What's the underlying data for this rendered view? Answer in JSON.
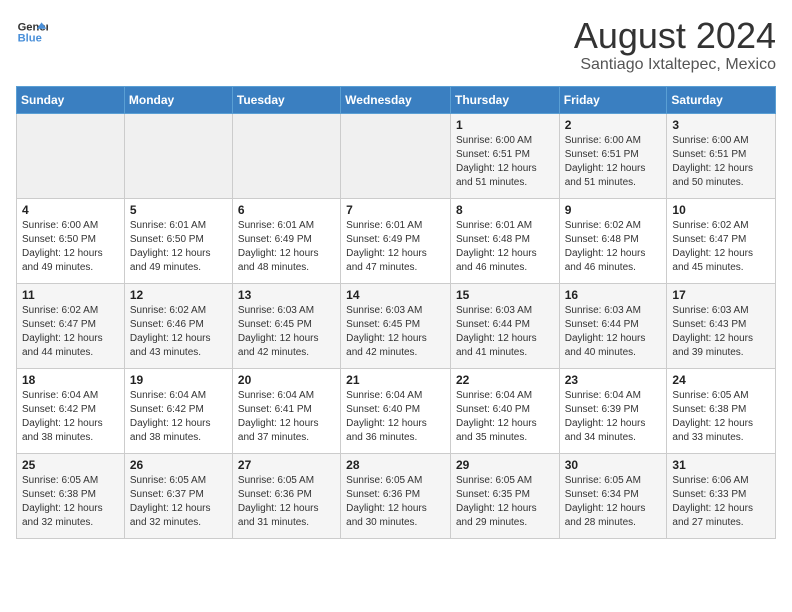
{
  "header": {
    "logo_line1": "General",
    "logo_line2": "Blue",
    "main_title": "August 2024",
    "sub_title": "Santiago Ixtaltepec, Mexico"
  },
  "weekdays": [
    "Sunday",
    "Monday",
    "Tuesday",
    "Wednesday",
    "Thursday",
    "Friday",
    "Saturday"
  ],
  "weeks": [
    [
      {
        "day": "",
        "info": ""
      },
      {
        "day": "",
        "info": ""
      },
      {
        "day": "",
        "info": ""
      },
      {
        "day": "",
        "info": ""
      },
      {
        "day": "1",
        "info": "Sunrise: 6:00 AM\nSunset: 6:51 PM\nDaylight: 12 hours\nand 51 minutes."
      },
      {
        "day": "2",
        "info": "Sunrise: 6:00 AM\nSunset: 6:51 PM\nDaylight: 12 hours\nand 51 minutes."
      },
      {
        "day": "3",
        "info": "Sunrise: 6:00 AM\nSunset: 6:51 PM\nDaylight: 12 hours\nand 50 minutes."
      }
    ],
    [
      {
        "day": "4",
        "info": "Sunrise: 6:00 AM\nSunset: 6:50 PM\nDaylight: 12 hours\nand 49 minutes."
      },
      {
        "day": "5",
        "info": "Sunrise: 6:01 AM\nSunset: 6:50 PM\nDaylight: 12 hours\nand 49 minutes."
      },
      {
        "day": "6",
        "info": "Sunrise: 6:01 AM\nSunset: 6:49 PM\nDaylight: 12 hours\nand 48 minutes."
      },
      {
        "day": "7",
        "info": "Sunrise: 6:01 AM\nSunset: 6:49 PM\nDaylight: 12 hours\nand 47 minutes."
      },
      {
        "day": "8",
        "info": "Sunrise: 6:01 AM\nSunset: 6:48 PM\nDaylight: 12 hours\nand 46 minutes."
      },
      {
        "day": "9",
        "info": "Sunrise: 6:02 AM\nSunset: 6:48 PM\nDaylight: 12 hours\nand 46 minutes."
      },
      {
        "day": "10",
        "info": "Sunrise: 6:02 AM\nSunset: 6:47 PM\nDaylight: 12 hours\nand 45 minutes."
      }
    ],
    [
      {
        "day": "11",
        "info": "Sunrise: 6:02 AM\nSunset: 6:47 PM\nDaylight: 12 hours\nand 44 minutes."
      },
      {
        "day": "12",
        "info": "Sunrise: 6:02 AM\nSunset: 6:46 PM\nDaylight: 12 hours\nand 43 minutes."
      },
      {
        "day": "13",
        "info": "Sunrise: 6:03 AM\nSunset: 6:45 PM\nDaylight: 12 hours\nand 42 minutes."
      },
      {
        "day": "14",
        "info": "Sunrise: 6:03 AM\nSunset: 6:45 PM\nDaylight: 12 hours\nand 42 minutes."
      },
      {
        "day": "15",
        "info": "Sunrise: 6:03 AM\nSunset: 6:44 PM\nDaylight: 12 hours\nand 41 minutes."
      },
      {
        "day": "16",
        "info": "Sunrise: 6:03 AM\nSunset: 6:44 PM\nDaylight: 12 hours\nand 40 minutes."
      },
      {
        "day": "17",
        "info": "Sunrise: 6:03 AM\nSunset: 6:43 PM\nDaylight: 12 hours\nand 39 minutes."
      }
    ],
    [
      {
        "day": "18",
        "info": "Sunrise: 6:04 AM\nSunset: 6:42 PM\nDaylight: 12 hours\nand 38 minutes."
      },
      {
        "day": "19",
        "info": "Sunrise: 6:04 AM\nSunset: 6:42 PM\nDaylight: 12 hours\nand 38 minutes."
      },
      {
        "day": "20",
        "info": "Sunrise: 6:04 AM\nSunset: 6:41 PM\nDaylight: 12 hours\nand 37 minutes."
      },
      {
        "day": "21",
        "info": "Sunrise: 6:04 AM\nSunset: 6:40 PM\nDaylight: 12 hours\nand 36 minutes."
      },
      {
        "day": "22",
        "info": "Sunrise: 6:04 AM\nSunset: 6:40 PM\nDaylight: 12 hours\nand 35 minutes."
      },
      {
        "day": "23",
        "info": "Sunrise: 6:04 AM\nSunset: 6:39 PM\nDaylight: 12 hours\nand 34 minutes."
      },
      {
        "day": "24",
        "info": "Sunrise: 6:05 AM\nSunset: 6:38 PM\nDaylight: 12 hours\nand 33 minutes."
      }
    ],
    [
      {
        "day": "25",
        "info": "Sunrise: 6:05 AM\nSunset: 6:38 PM\nDaylight: 12 hours\nand 32 minutes."
      },
      {
        "day": "26",
        "info": "Sunrise: 6:05 AM\nSunset: 6:37 PM\nDaylight: 12 hours\nand 32 minutes."
      },
      {
        "day": "27",
        "info": "Sunrise: 6:05 AM\nSunset: 6:36 PM\nDaylight: 12 hours\nand 31 minutes."
      },
      {
        "day": "28",
        "info": "Sunrise: 6:05 AM\nSunset: 6:36 PM\nDaylight: 12 hours\nand 30 minutes."
      },
      {
        "day": "29",
        "info": "Sunrise: 6:05 AM\nSunset: 6:35 PM\nDaylight: 12 hours\nand 29 minutes."
      },
      {
        "day": "30",
        "info": "Sunrise: 6:05 AM\nSunset: 6:34 PM\nDaylight: 12 hours\nand 28 minutes."
      },
      {
        "day": "31",
        "info": "Sunrise: 6:06 AM\nSunset: 6:33 PM\nDaylight: 12 hours\nand 27 minutes."
      }
    ]
  ]
}
